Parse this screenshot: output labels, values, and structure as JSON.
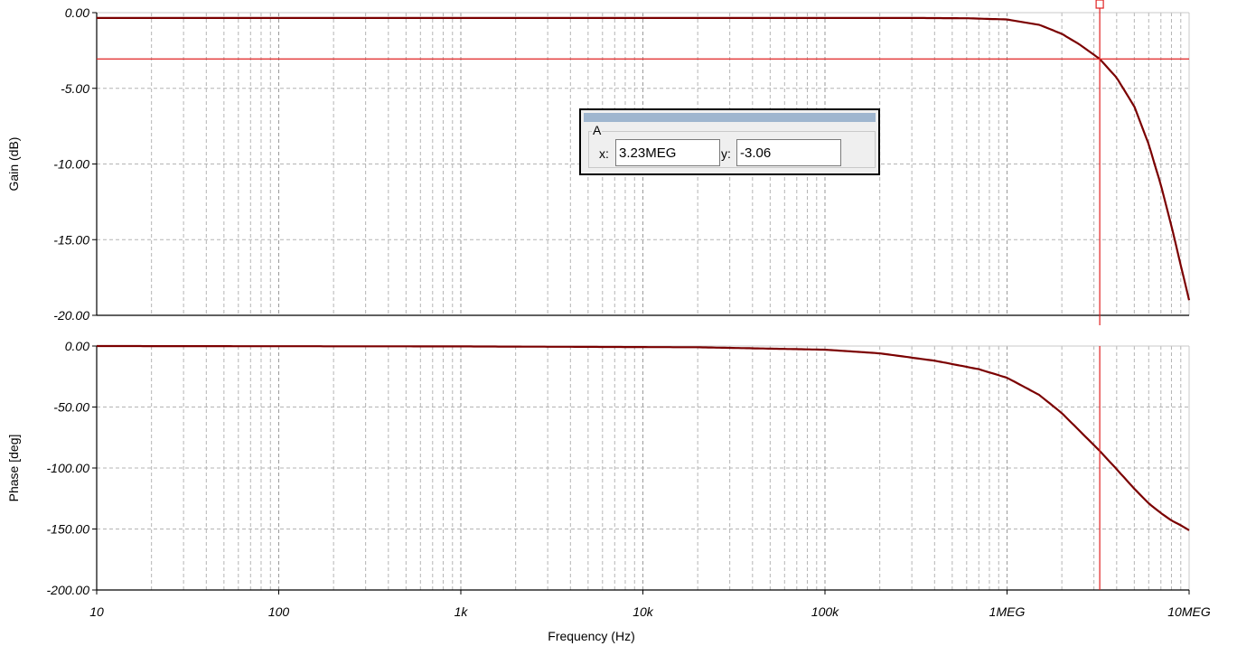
{
  "chart_data": [
    {
      "type": "line",
      "ylabel": "Gain (dB)",
      "xscale": "log",
      "xlim": [
        10,
        10000000
      ],
      "ylim": [
        -20,
        0
      ],
      "y_ticks": [
        "0.00",
        "-5.00",
        "-10.00",
        "-15.00",
        "-20.00"
      ],
      "grid": true,
      "line_color": "#7b0000",
      "series": [
        {
          "x": [
            10,
            100,
            1000,
            10000,
            100000,
            300000,
            600000,
            1000000,
            1500000,
            2000000,
            2500000,
            3230000,
            4000000,
            5000000,
            6000000,
            7000000,
            8000000,
            9000000,
            10000000
          ],
          "values": [
            -0.35,
            -0.35,
            -0.35,
            -0.35,
            -0.35,
            -0.35,
            -0.37,
            -0.45,
            -0.8,
            -1.4,
            -2.1,
            -3.06,
            -4.3,
            -6.2,
            -8.7,
            -11.4,
            -14.1,
            -16.7,
            -19.0
          ]
        }
      ],
      "hline": {
        "y": -3.06,
        "color": "#e02020"
      }
    },
    {
      "type": "line",
      "ylabel": "Phase [deg]",
      "xlabel": "Frequency (Hz)",
      "xscale": "log",
      "xlim": [
        10,
        10000000
      ],
      "ylim": [
        -200,
        0
      ],
      "y_ticks": [
        "0.00",
        "-50.00",
        "-100.00",
        "-150.00",
        "-200.00"
      ],
      "x_ticks": [
        "10",
        "100",
        "1k",
        "10k",
        "100k",
        "1MEG",
        "10MEG"
      ],
      "grid": true,
      "line_color": "#7b0000",
      "series": [
        {
          "x": [
            10,
            1000,
            20000,
            100000,
            200000,
            400000,
            700000,
            1000000,
            1500000,
            2000000,
            3230000,
            4000000,
            5000000,
            6000000,
            7000000,
            8000000,
            9000000,
            10000000
          ],
          "values": [
            0,
            -0.3,
            -1,
            -3,
            -6,
            -12,
            -19,
            -26,
            -40,
            -55,
            -86,
            -101,
            -117,
            -129,
            -137,
            -143,
            -147,
            -151
          ]
        }
      ]
    }
  ],
  "cursor": {
    "x_value": 3230000,
    "color": "#e02020",
    "group": "A",
    "x_label": "x:",
    "x_value_text": "3.23MEG",
    "y_label": "y:",
    "y_value_text": "-3.06"
  }
}
